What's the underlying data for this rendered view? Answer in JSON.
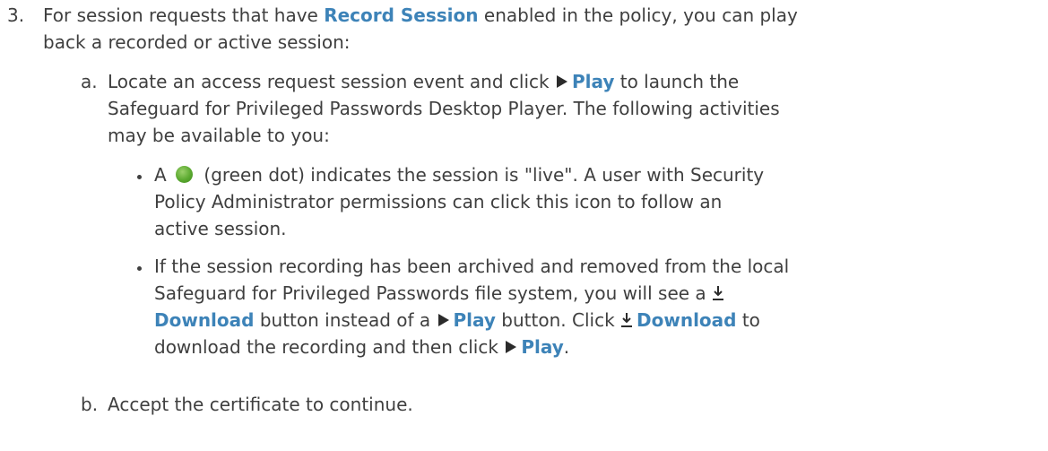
{
  "step3": {
    "marker": "3.",
    "line1_pre": "For session requests that have ",
    "line1_bold": "Record Session",
    "line1_post": " enabled in the policy, you can play",
    "line2": "back a recorded or active session:"
  },
  "sub_a": {
    "marker": "a.",
    "line1_pre": "Locate an access request session event and click ",
    "play_label": "Play",
    "line1_post": " to launch the",
    "line2": "Safeguard for Privileged Passwords Desktop Player. The following activities",
    "line3": "may be available to you:"
  },
  "bullet1": {
    "pre": "A ",
    "line1_post": " (green dot) indicates the session is \"live\". A user with Security",
    "line2": "Policy Administrator permissions can click this icon to follow an",
    "line3": "active session."
  },
  "bullet2": {
    "line1": "If the session recording has been archived and removed from the local",
    "line2": "Safeguard for Privileged Passwords file system, you will see a",
    "download_label": "Download",
    "line3_mid": " button instead of a ",
    "play_label": "Play",
    "line3_post": " button. Click ",
    "download_label2": "Download",
    "line3_end": " to",
    "line4_pre": "download the recording and then click ",
    "play_label2": "Play",
    "line4_end": "."
  },
  "sub_b": {
    "marker": "b.",
    "text": "Accept the certificate to continue."
  },
  "icons": {
    "play": "play-triangle-icon",
    "live": "green-dot-icon",
    "download": "download-arrow-icon"
  },
  "colors": {
    "text": "#3f3f3f",
    "link_bold": "#3d83b8",
    "green_dot": "#5aa92f"
  }
}
